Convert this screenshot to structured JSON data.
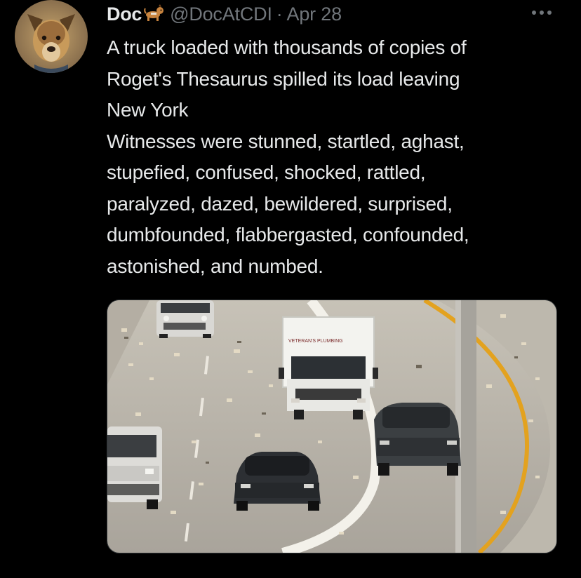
{
  "tweet": {
    "display_name": "Doc",
    "handle": "@DocAtCDI",
    "separator": "·",
    "timestamp": "Apr 28",
    "text_lines": [
      "A truck loaded with thousands of copies of",
      "Roget's Thesaurus spilled its load leaving",
      "New York",
      "Witnesses were stunned, startled, aghast,",
      "stupefied, confused, shocked, rattled,",
      "paralyzed, dazed, bewildered, surprised,",
      "dumbfounded, flabbergasted, confounded,",
      "astonished, and numbed."
    ],
    "name_emoji": "dog-emoji",
    "more_icon": "more-horizontal-icon",
    "media": {
      "truck_sign_text": "VETERAN'S PLUMBING"
    }
  },
  "colors": {
    "background": "#000000",
    "primary_text": "#e7e9ea",
    "secondary_text": "#71767b",
    "road": "#b9b4aa",
    "yellow_line": "#e3a21f"
  }
}
